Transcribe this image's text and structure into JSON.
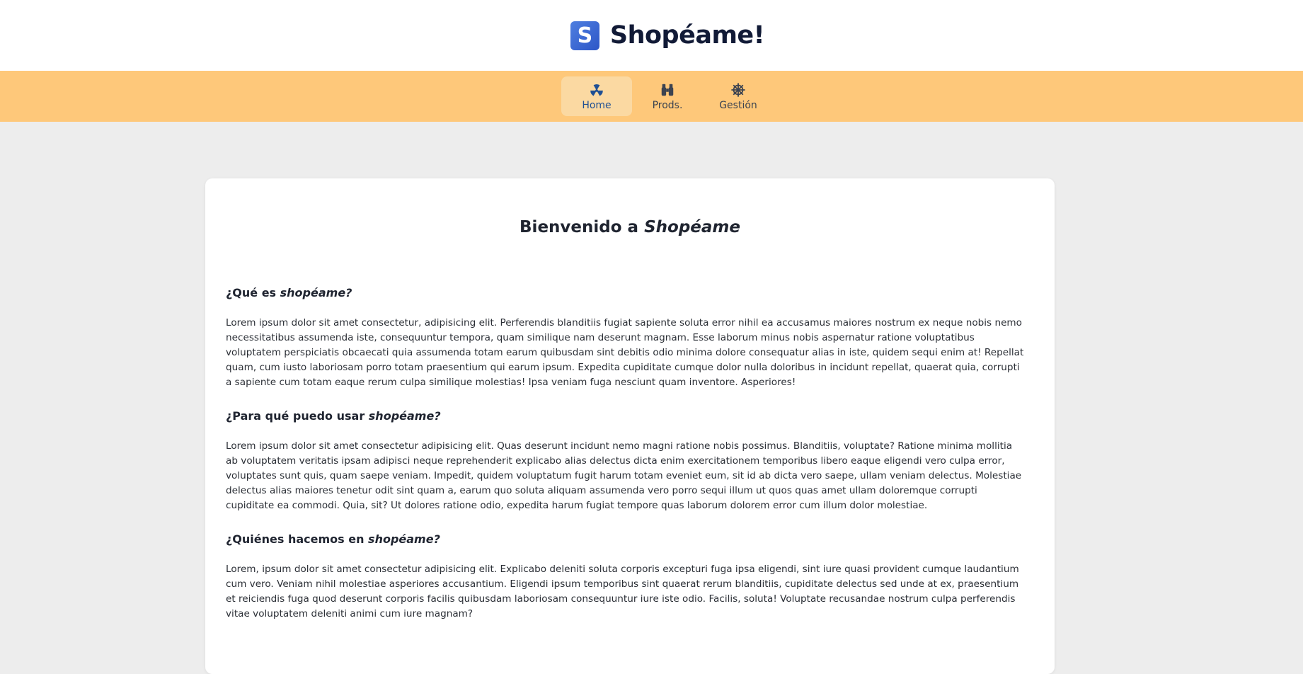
{
  "header": {
    "logo_letter": "S",
    "brand_name": "Shopéame!"
  },
  "nav": {
    "items": [
      {
        "label": "Home",
        "icon": "radiation-icon",
        "active": true
      },
      {
        "label": "Prods.",
        "icon": "binoculars-icon",
        "active": false
      },
      {
        "label": "Gestión",
        "icon": "ship-wheel-icon",
        "active": false
      }
    ]
  },
  "main": {
    "title_prefix": "Bienvenido a ",
    "title_emph": "Shopéame",
    "sections": [
      {
        "heading_prefix": "¿Qué es ",
        "heading_emph": "shopéame?",
        "body": "Lorem ipsum dolor sit amet consectetur, adipisicing elit. Perferendis blanditiis fugiat sapiente soluta error nihil ea accusamus maiores nostrum ex neque nobis nemo necessitatibus assumenda iste, consequuntur tempora, quam similique nam deserunt magnam. Esse laborum minus nobis aspernatur ratione voluptatibus voluptatem perspiciatis obcaecati quia assumenda totam earum quibusdam sint debitis odio minima dolore consequatur alias in iste, quidem sequi enim at! Repellat quam, cum iusto laboriosam porro totam praesentium qui earum ipsum. Expedita cupiditate cumque dolor nulla doloribus in incidunt repellat, quaerat quia, corrupti a sapiente cum totam eaque rerum culpa similique molestias! Ipsa veniam fuga nesciunt quam inventore. Asperiores!"
      },
      {
        "heading_prefix": "¿Para qué puedo usar ",
        "heading_emph": "shopéame?",
        "body": "Lorem ipsum dolor sit amet consectetur adipisicing elit. Quas deserunt incidunt nemo magni ratione nobis possimus. Blanditiis, voluptate? Ratione minima mollitia ab voluptatem veritatis ipsam adipisci neque reprehenderit explicabo alias delectus dicta enim exercitationem temporibus libero eaque eligendi vero culpa error, voluptates sunt quis, quam saepe veniam. Impedit, quidem voluptatum fugit harum totam eveniet eum, sit id ab dicta vero saepe, ullam veniam delectus. Molestiae delectus alias maiores tenetur odit sint quam a, earum quo soluta aliquam assumenda vero porro sequi illum ut quos quas amet ullam doloremque corrupti cupiditate ea commodi. Quia, sit? Ut dolores ratione odio, expedita harum fugiat tempore quas laborum dolorem error cum illum dolor molestiae."
      },
      {
        "heading_prefix": "¿Quiénes hacemos en ",
        "heading_emph": "shopéame?",
        "body": "Lorem, ipsum dolor sit amet consectetur adipisicing elit. Explicabo deleniti soluta corporis excepturi fuga ipsa eligendi, sint iure quasi provident cumque laudantium cum vero. Veniam nihil molestiae asperiores accusantium. Eligendi ipsum temporibus sint quaerat rerum blanditiis, cupiditate delectus sed unde at ex, praesentium et reiciendis fuga quod deserunt corporis facilis quibusdam laboriosam consequuntur iure iste odio. Facilis, soluta! Voluptate recusandae nostrum culpa perferendis vitae voluptatem deleniti animi cum iure magnam?"
      }
    ]
  },
  "colors": {
    "nav_background": "#fec87a",
    "nav_active_background": "#fbd9a2",
    "nav_active_text": "#1f4f93",
    "logo_blue": "#3a68d4",
    "brand_text": "#111a36",
    "page_background": "#ededed"
  }
}
